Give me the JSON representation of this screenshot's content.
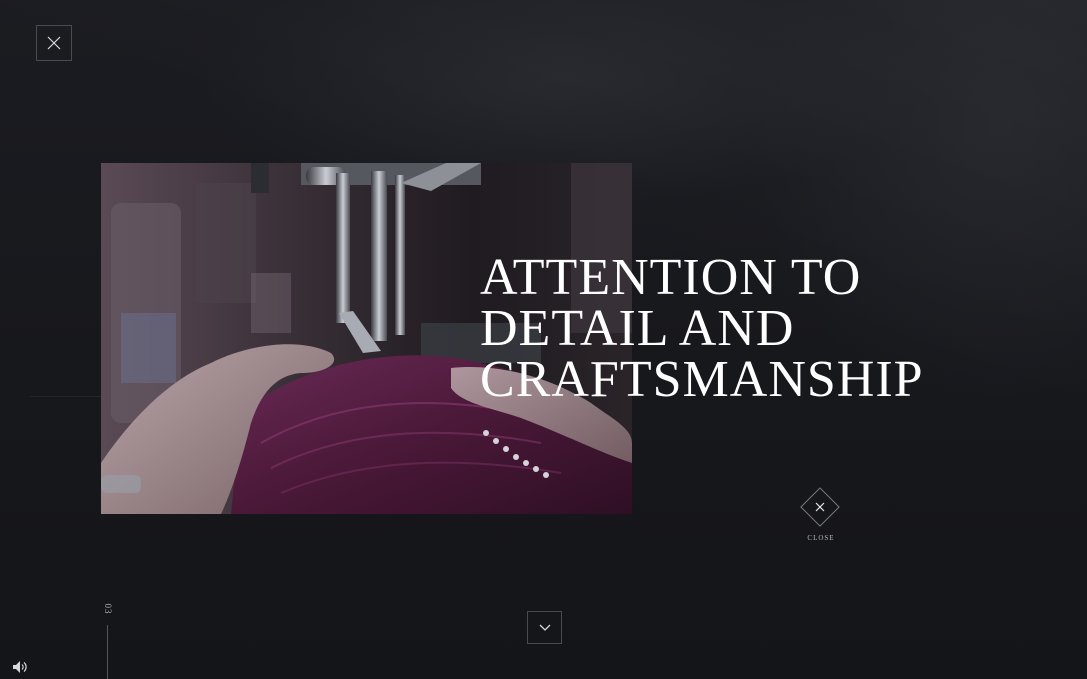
{
  "hero": {
    "headline_lines": [
      "ATTENTION TO",
      "DETAIL AND",
      "CRAFTSMANSHIP"
    ]
  },
  "controls": {
    "close_label": "CLOSE",
    "slide_number": "03"
  },
  "icons": {
    "top_close": "close-icon",
    "diamond_close": "close-icon",
    "scroll_down": "chevron-down-icon",
    "sound": "speaker-icon"
  },
  "colors": {
    "background": "#17181c",
    "text": "#ffffff",
    "muted_text": "#b8b9be",
    "border": "#4a4b52"
  }
}
